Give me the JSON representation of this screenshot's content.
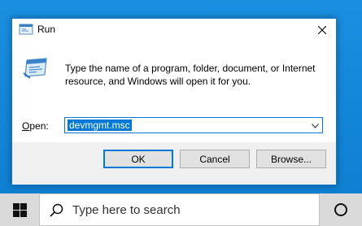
{
  "dialog": {
    "title": "Run",
    "description": "Type the name of a program, folder, document, or Internet resource, and Windows will open it for you.",
    "open_label_prefix": "",
    "open_label_mnemonic": "O",
    "open_label_rest": "pen:",
    "open_value": "devmgmt.msc",
    "buttons": {
      "ok": "OK",
      "cancel": "Cancel",
      "browse": "Browse..."
    }
  },
  "taskbar": {
    "search_placeholder": "Type here to search"
  },
  "colors": {
    "accent": "#0078d7",
    "desktop": "#1485d6",
    "taskbar": "#dadada"
  },
  "icons": {
    "title": "run-icon",
    "dialog": "run-large-icon",
    "close": "close-icon",
    "dropdown": "chevron-down-icon",
    "start": "windows-logo-icon",
    "search": "search-icon",
    "cortana": "cortana-circle-icon"
  }
}
